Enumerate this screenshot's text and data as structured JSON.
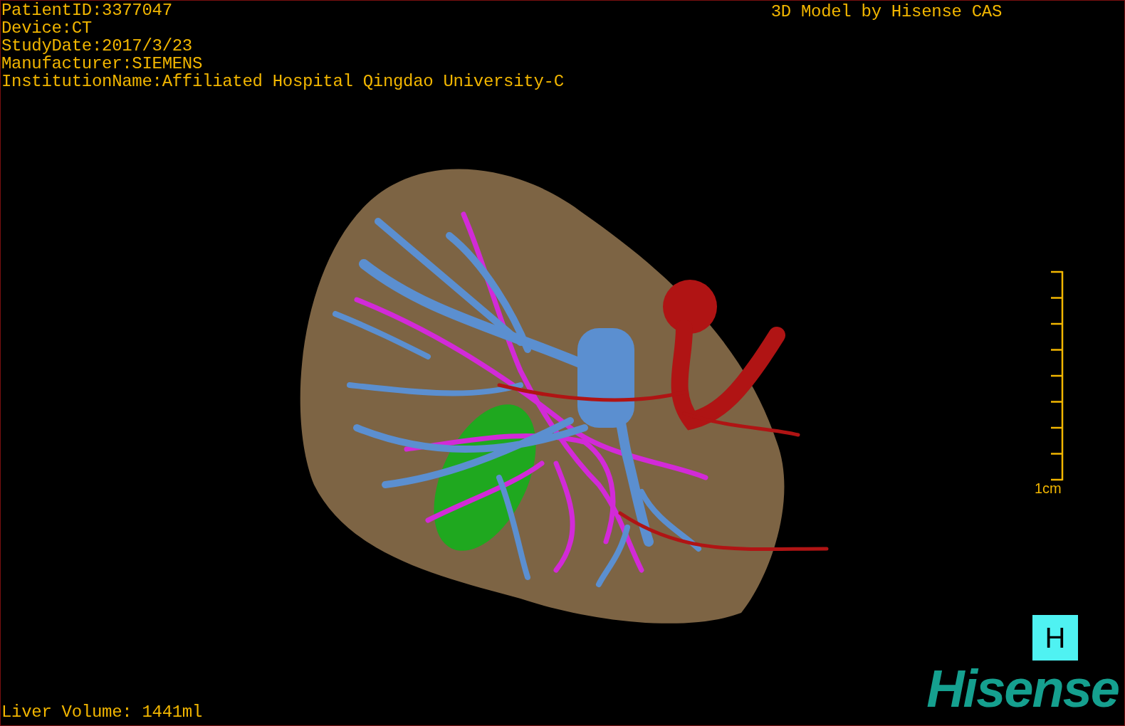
{
  "info_lines": [
    "PatientID:3377047",
    "Device:CT",
    "StudyDate:2017/3/23",
    "Manufacturer:SIEMENS",
    "InstitutionName:Affiliated Hospital Qingdao University-C"
  ],
  "credit": "3D Model by Hisense CAS",
  "scale_bar": {
    "label": "1cm"
  },
  "orientation_button": "H",
  "liver_volume": "Liver Volume: 1441ml",
  "logo": "Hisense"
}
